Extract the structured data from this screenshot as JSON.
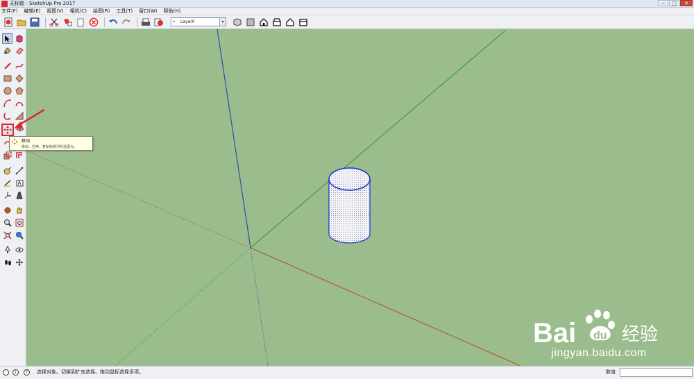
{
  "window": {
    "title": "无标题 - SketchUp Pro 2017",
    "minimize": "─",
    "maximize": "□",
    "close": "✕"
  },
  "menu": [
    "文件(F)",
    "编辑(E)",
    "视图(V)",
    "相机(C)",
    "绘图(R)",
    "工具(T)",
    "窗口(W)",
    "帮助(H)"
  ],
  "toolbar": {
    "layer": "Layer0"
  },
  "tooltip": {
    "title": "移动",
    "description": "移动、拉伸、复制和排列所选图元。"
  },
  "statusbar": {
    "message": "选择对象。切换到扩充选择。拖动鼠标选择多项。",
    "value_label": "数值",
    "value": ""
  },
  "watermark": {
    "brand": "Bai",
    "brand2": "du",
    "brand_cn": "经验",
    "url": "jingyan.baidu.com"
  },
  "colors": {
    "viewport": "#9bbc8d",
    "axis_red": "#b5492f",
    "axis_green": "#2d9c25",
    "axis_blue": "#3b4aa8",
    "highlight": "#d92b2b"
  }
}
